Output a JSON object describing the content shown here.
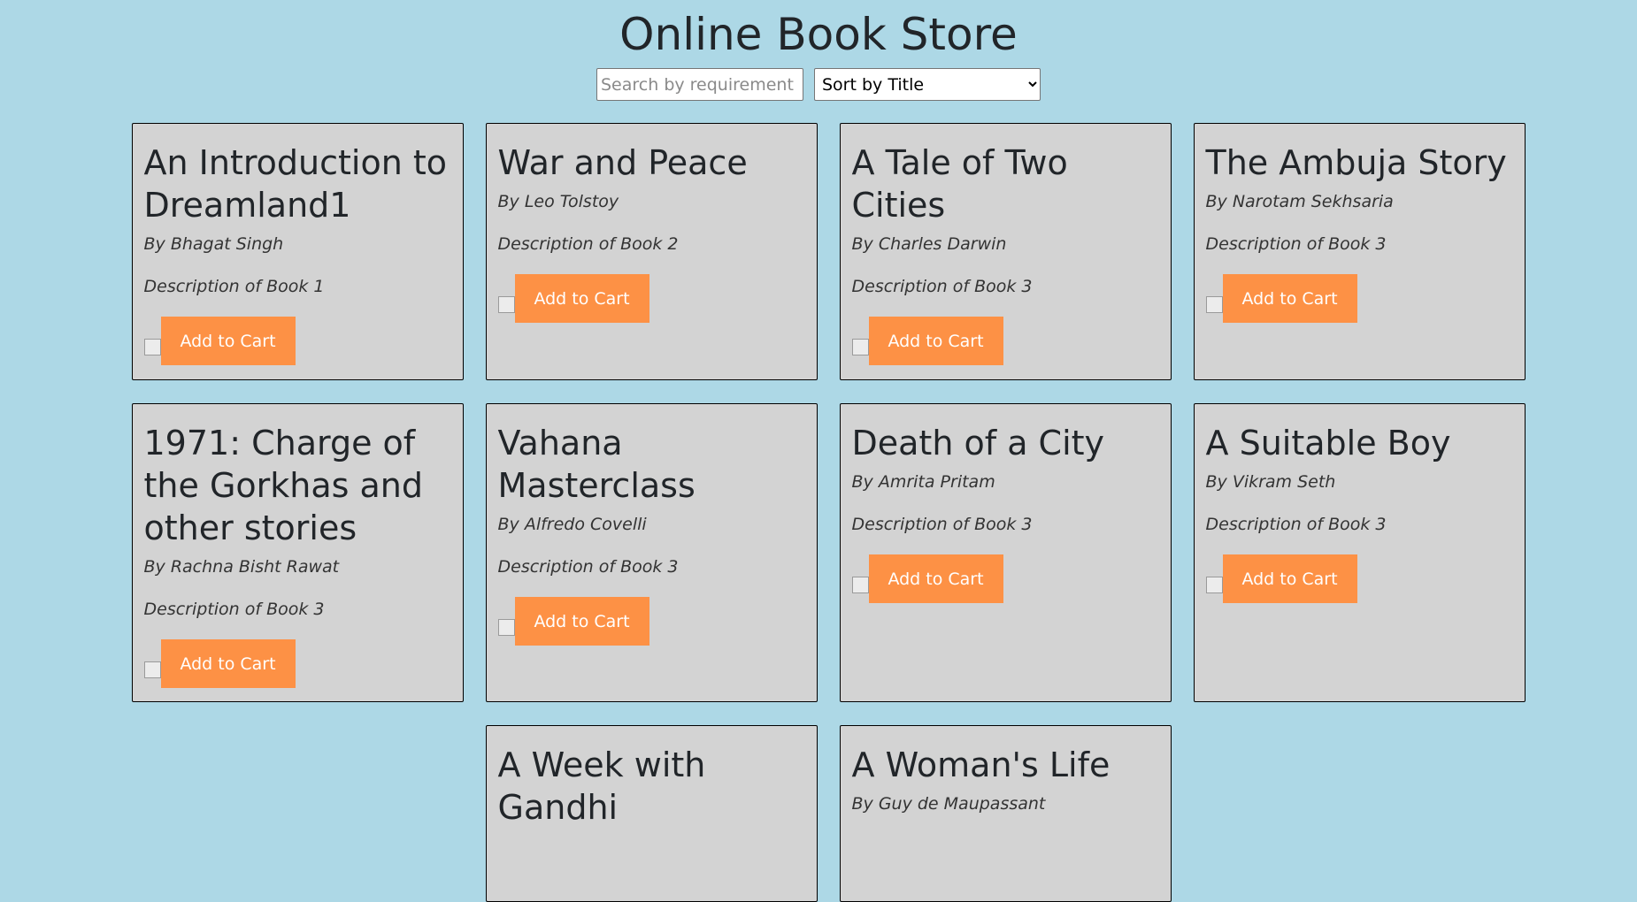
{
  "page": {
    "title": "Online Book Store"
  },
  "controls": {
    "search_placeholder": "Search by requirement",
    "search_value": "",
    "sort_options": [
      "Sort by Title"
    ],
    "sort_selected": "Sort by Title"
  },
  "colors": {
    "background": "#add8e6",
    "card_background": "#d3d3d3",
    "button_background": "#fd9145",
    "button_text": "#ffffff",
    "text": "#212529"
  },
  "books": [
    {
      "title": "An Introduction to Dreamland1",
      "author": "By Bhagat Singh",
      "description": "Description of Book 1",
      "button_label": "Add to Cart"
    },
    {
      "title": "War and Peace",
      "author": "By Leo Tolstoy",
      "description": "Description of Book 2",
      "button_label": "Add to Cart"
    },
    {
      "title": "A Tale of Two Cities",
      "author": "By Charles Darwin",
      "description": "Description of Book 3",
      "button_label": "Add to Cart"
    },
    {
      "title": "The Ambuja Story",
      "author": "By Narotam Sekhsaria",
      "description": "Description of Book 3",
      "button_label": "Add to Cart"
    },
    {
      "title": "1971: Charge of the Gorkhas and other stories",
      "author": "By Rachna Bisht Rawat",
      "description": "Description of Book 3",
      "button_label": "Add to Cart"
    },
    {
      "title": "Vahana Masterclass",
      "author": "By Alfredo Covelli",
      "description": "Description of Book 3",
      "button_label": "Add to Cart"
    },
    {
      "title": "Death of a City",
      "author": "By Amrita Pritam",
      "description": "Description of Book 3",
      "button_label": "Add to Cart"
    },
    {
      "title": "A Suitable Boy",
      "author": "By Vikram Seth",
      "description": "Description of Book 3",
      "button_label": "Add to Cart"
    },
    {
      "title": "A Week with Gandhi",
      "author": "",
      "description": "",
      "button_label": ""
    },
    {
      "title": "A Woman's Life",
      "author": "By Guy de Maupassant",
      "description": "",
      "button_label": ""
    }
  ]
}
